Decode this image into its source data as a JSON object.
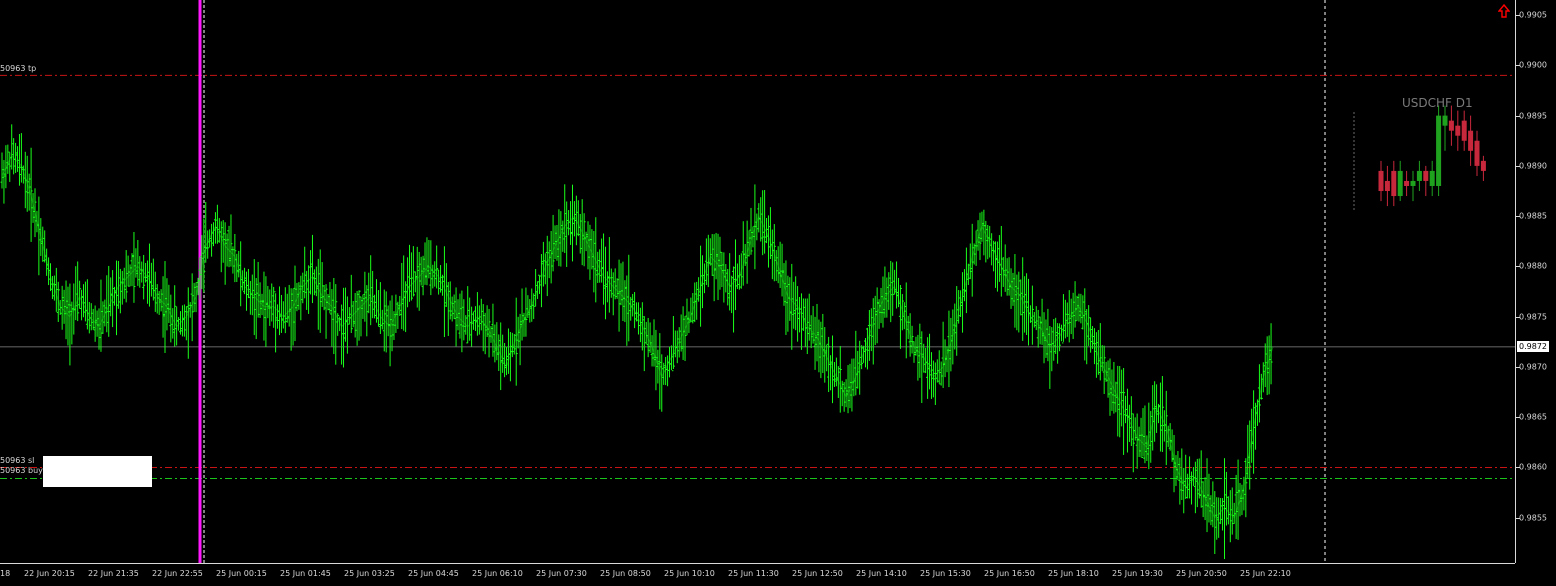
{
  "symbol_label": "USDCHF D1",
  "current_price": "0.9872",
  "price_axis": {
    "min": 0.98505,
    "max": 0.99065,
    "ticks": [
      "0.9905",
      "0.9900",
      "0.9895",
      "0.9890",
      "0.9885",
      "0.9880",
      "0.9875",
      "0.9870",
      "0.9865",
      "0.9860",
      "0.9855"
    ]
  },
  "time_axis": {
    "labels": [
      "18",
      "22 Jun 20:15",
      "22 Jun 21:35",
      "22 Jun 22:55",
      "25 Jun 00:15",
      "25 Jun 01:45",
      "25 Jun 03:25",
      "25 Jun 04:45",
      "25 Jun 06:10",
      "25 Jun 07:30",
      "25 Jun 08:50",
      "25 Jun 10:10",
      "25 Jun 11:30",
      "25 Jun 12:50",
      "25 Jun 14:10",
      "25 Jun 15:30",
      "25 Jun 16:50",
      "25 Jun 18:10",
      "25 Jun 19:30",
      "25 Jun 20:50",
      "25 Jun 22:10"
    ]
  },
  "order_lines": {
    "tp": {
      "label": "50963 tp",
      "price": 0.9899,
      "color": "#c81414"
    },
    "sl": {
      "label": "50963 sl",
      "price": 0.986,
      "color": "#c81414"
    },
    "buy": {
      "label": "50963 buy",
      "price": 0.98589,
      "color": "#19c619"
    }
  },
  "colors": {
    "bars": "#19ff19",
    "grid_text": "#d8d8d8",
    "session_line": "#ff19ff",
    "bull_candle": "#1fa31f",
    "bear_candle": "#c8283c",
    "arrow_icon": "#ff0000"
  },
  "chart_data": {
    "type": "line",
    "title": "USDCHF D1",
    "ylim": [
      0.98505,
      0.99065
    ],
    "series": [
      {
        "values": [
          0.9889,
          0.9891,
          0.989,
          0.9887,
          0.9883,
          0.9879,
          0.9876,
          0.9875,
          0.9877,
          0.9875,
          0.9874,
          0.9876,
          0.9878,
          0.9879,
          0.988,
          0.9879,
          0.9877,
          0.9876,
          0.9874,
          0.9875,
          0.9877,
          0.9882,
          0.9884,
          0.9882,
          0.9881,
          0.9878,
          0.9877,
          0.9876,
          0.9876,
          0.9875,
          0.9876,
          0.9878,
          0.9879,
          0.9877,
          0.9876,
          0.9874,
          0.9875,
          0.9876,
          0.9877,
          0.9875,
          0.9874,
          0.9876,
          0.9878,
          0.9879,
          0.988,
          0.9879,
          0.9877,
          0.9875,
          0.9874,
          0.9875,
          0.9874,
          0.9872,
          0.987,
          0.9873,
          0.9875,
          0.9877,
          0.988,
          0.9882,
          0.9884,
          0.9885,
          0.9883,
          0.9881,
          0.9879,
          0.9878,
          0.9877,
          0.9876,
          0.9874,
          0.9872,
          0.9869,
          0.9871,
          0.9873,
          0.9875,
          0.9878,
          0.9881,
          0.988,
          0.9878,
          0.9879,
          0.9882,
          0.9885,
          0.9883,
          0.988,
          0.9877,
          0.9876,
          0.9874,
          0.9873,
          0.9871,
          0.9869,
          0.9867,
          0.9869,
          0.9872,
          0.9875,
          0.9877,
          0.9878,
          0.9875,
          0.9872,
          0.9871,
          0.9869,
          0.987,
          0.9873,
          0.9877,
          0.9881,
          0.9884,
          0.9882,
          0.988,
          0.9878,
          0.9877,
          0.9875,
          0.9874,
          0.9872,
          0.9873,
          0.9875,
          0.9876,
          0.9874,
          0.9871,
          0.9869,
          0.9867,
          0.9865,
          0.9863,
          0.9862,
          0.9866,
          0.9864,
          0.986,
          0.9858,
          0.9859,
          0.9857,
          0.9855,
          0.9856,
          0.9855,
          0.9858,
          0.9864,
          0.9869,
          0.9872
        ]
      }
    ]
  },
  "mini_chart": {
    "candles": [
      {
        "o": 0.98895,
        "c": 0.98875,
        "h": 0.98905,
        "l": 0.98865
      },
      {
        "o": 0.98885,
        "c": 0.98875,
        "h": 0.989,
        "l": 0.9886
      },
      {
        "o": 0.98895,
        "c": 0.9887,
        "h": 0.98905,
        "l": 0.9886
      },
      {
        "o": 0.9887,
        "c": 0.98895,
        "h": 0.98905,
        "l": 0.98865
      },
      {
        "o": 0.98885,
        "c": 0.9888,
        "h": 0.98895,
        "l": 0.9887
      },
      {
        "o": 0.9888,
        "c": 0.98885,
        "h": 0.98895,
        "l": 0.98865
      },
      {
        "o": 0.98885,
        "c": 0.98895,
        "h": 0.98905,
        "l": 0.98875
      },
      {
        "o": 0.98895,
        "c": 0.98885,
        "h": 0.989,
        "l": 0.9887
      },
      {
        "o": 0.9888,
        "c": 0.98895,
        "h": 0.98905,
        "l": 0.9887
      },
      {
        "o": 0.9888,
        "c": 0.9895,
        "h": 0.9896,
        "l": 0.9887
      },
      {
        "o": 0.9894,
        "c": 0.9895,
        "h": 0.9896,
        "l": 0.98915
      },
      {
        "o": 0.98945,
        "c": 0.98935,
        "h": 0.9896,
        "l": 0.9892
      },
      {
        "o": 0.9894,
        "c": 0.9893,
        "h": 0.98955,
        "l": 0.98915
      },
      {
        "o": 0.98945,
        "c": 0.98925,
        "h": 0.98955,
        "l": 0.98915
      },
      {
        "o": 0.98935,
        "c": 0.98915,
        "h": 0.9895,
        "l": 0.989
      },
      {
        "o": 0.98925,
        "c": 0.989,
        "h": 0.98935,
        "l": 0.9889
      },
      {
        "o": 0.98905,
        "c": 0.98895,
        "h": 0.9891,
        "l": 0.98885
      }
    ]
  }
}
